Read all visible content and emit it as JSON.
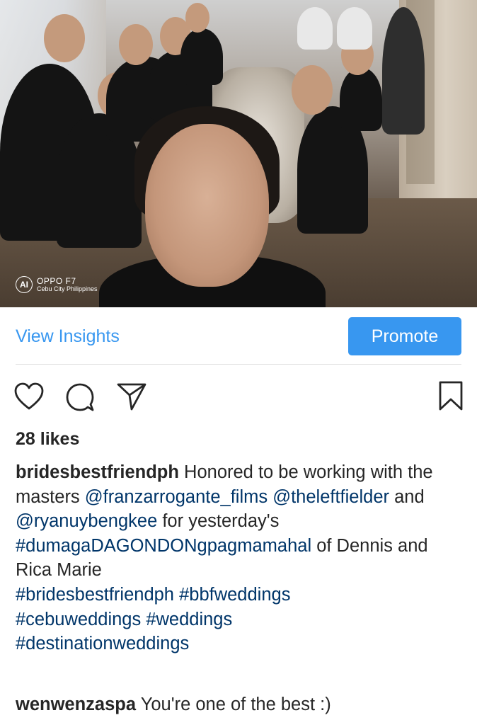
{
  "photo": {
    "camera_badge": {
      "logo": "AI",
      "model": "OPPO F7",
      "location": "Cebu City Philippines"
    }
  },
  "insights": {
    "view_insights_label": "View Insights",
    "promote_label": "Promote"
  },
  "actions": {
    "icons": [
      "heart-icon",
      "comment-icon",
      "share-icon",
      "bookmark-icon"
    ]
  },
  "post": {
    "likes": "28 likes",
    "caption": {
      "username": "bridesbestfriendph",
      "segments": [
        {
          "text": " Honored to be working with the masters ",
          "type": "text"
        },
        {
          "text": "@franzarrogante_films",
          "type": "mention"
        },
        {
          "text": " ",
          "type": "text"
        },
        {
          "text": "@theleftfielder",
          "type": "mention"
        },
        {
          "text": " and ",
          "type": "text"
        },
        {
          "text": "@ryanuybengkee",
          "type": "mention"
        },
        {
          "text": " for yesterday's ",
          "type": "text"
        },
        {
          "text": "#dumagaDAGONDONgpagmamahal",
          "type": "hashtag"
        },
        {
          "text": " of Dennis and Rica Marie",
          "type": "text"
        },
        {
          "text": "#bridesbestfriendph",
          "type": "hashtag"
        },
        {
          "text": "#bbfweddings",
          "type": "hashtag"
        },
        {
          "text": "#cebuweddings",
          "type": "hashtag"
        },
        {
          "text": "#weddings",
          "type": "hashtag"
        },
        {
          "text": "#destinationweddings",
          "type": "hashtag"
        }
      ]
    },
    "comment": {
      "username": "wenwenzaspa",
      "text": "You're one of the best :)"
    }
  },
  "colors": {
    "link_blue": "#003569",
    "accent_blue": "#3897f0",
    "text": "#262626"
  }
}
